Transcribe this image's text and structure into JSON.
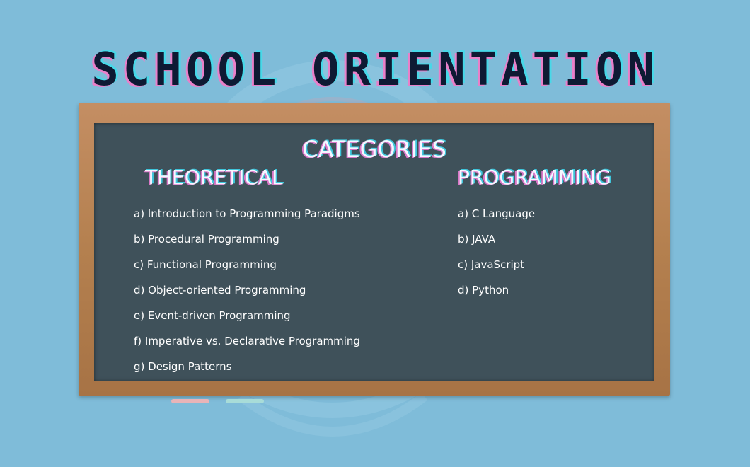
{
  "title": "SCHOOL ORIENTATION",
  "colors": {
    "background": "#7fbcd9",
    "board": "#3f515a",
    "frame": "#b4804f",
    "title": "#0e1a33",
    "accent_pink": "#e880c9",
    "accent_cyan": "#48d8e8"
  },
  "board": {
    "heading": "CATEGORIES",
    "theoretical": {
      "heading": "THEORETICAL",
      "items": [
        "a) Introduction to Programming Paradigms",
        "b) Procedural Programming",
        "c) Functional Programming",
        "d) Object-oriented Programming",
        "e) Event-driven Programming",
        "f) Imperative vs. Declarative Programming",
        "g) Design Patterns"
      ]
    },
    "programming": {
      "heading": "PROGRAMMING",
      "items": [
        "a) C Language",
        "b) JAVA",
        "c) JavaScript",
        "d) Python"
      ]
    }
  }
}
